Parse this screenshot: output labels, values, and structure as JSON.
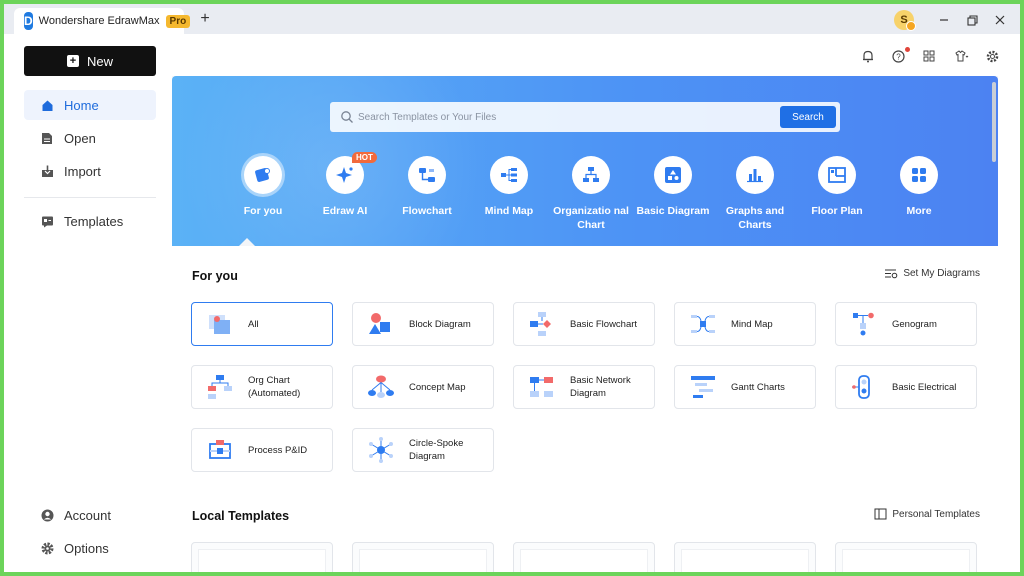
{
  "app": {
    "title": "Wondershare EdrawMax",
    "badge": "Pro",
    "new_tab": "+",
    "user_initial": "S"
  },
  "sidebar": {
    "new_label": "New",
    "items": [
      {
        "label": "Home",
        "active": true
      },
      {
        "label": "Open"
      },
      {
        "label": "Import"
      },
      {
        "label": "Templates"
      }
    ],
    "bottom": [
      {
        "label": "Account"
      },
      {
        "label": "Options"
      }
    ]
  },
  "search": {
    "placeholder": "Search Templates or Your Files",
    "button": "Search"
  },
  "categories": [
    {
      "label": "For you",
      "selected": true
    },
    {
      "label": "Edraw AI",
      "badge": "HOT"
    },
    {
      "label": "Flowchart"
    },
    {
      "label": "Mind Map"
    },
    {
      "label": "Organizatio nal Chart"
    },
    {
      "label": "Basic Diagram"
    },
    {
      "label": "Graphs and Charts"
    },
    {
      "label": "Floor Plan"
    },
    {
      "label": "More"
    }
  ],
  "for_you": {
    "title": "For you",
    "link": "Set My Diagrams",
    "cards": [
      {
        "label": "All",
        "selected": true
      },
      {
        "label": "Block Diagram"
      },
      {
        "label": "Basic Flowchart"
      },
      {
        "label": "Mind Map"
      },
      {
        "label": "Genogram"
      },
      {
        "label": "Org Chart (Automated)"
      },
      {
        "label": "Concept Map"
      },
      {
        "label": "Basic Network Diagram"
      },
      {
        "label": "Gantt Charts"
      },
      {
        "label": "Basic Electrical"
      },
      {
        "label": "Process P&ID"
      },
      {
        "label": "Circle-Spoke Diagram"
      }
    ]
  },
  "local_templates": {
    "title": "Local Templates",
    "link": "Personal Templates"
  },
  "colors": {
    "accent": "#1f6fe5",
    "hero_start": "#5bb2f6",
    "hero_end": "#4c82f2",
    "hot": "#f26a3c",
    "pro": "#f5b82e"
  }
}
